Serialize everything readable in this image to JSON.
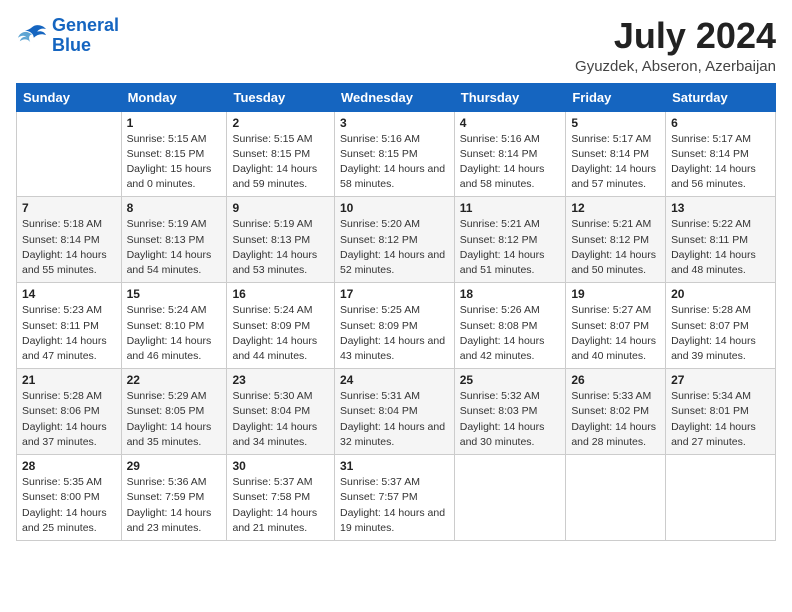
{
  "logo": {
    "line1": "General",
    "line2": "Blue"
  },
  "title": "July 2024",
  "subtitle": "Gyuzdek, Abseron, Azerbaijan",
  "weekdays": [
    "Sunday",
    "Monday",
    "Tuesday",
    "Wednesday",
    "Thursday",
    "Friday",
    "Saturday"
  ],
  "weeks": [
    [
      null,
      {
        "day": "1",
        "sunrise": "5:15 AM",
        "sunset": "8:15 PM",
        "daylight": "15 hours and 0 minutes."
      },
      {
        "day": "2",
        "sunrise": "5:15 AM",
        "sunset": "8:15 PM",
        "daylight": "14 hours and 59 minutes."
      },
      {
        "day": "3",
        "sunrise": "5:16 AM",
        "sunset": "8:15 PM",
        "daylight": "14 hours and 58 minutes."
      },
      {
        "day": "4",
        "sunrise": "5:16 AM",
        "sunset": "8:14 PM",
        "daylight": "14 hours and 58 minutes."
      },
      {
        "day": "5",
        "sunrise": "5:17 AM",
        "sunset": "8:14 PM",
        "daylight": "14 hours and 57 minutes."
      },
      {
        "day": "6",
        "sunrise": "5:17 AM",
        "sunset": "8:14 PM",
        "daylight": "14 hours and 56 minutes."
      }
    ],
    [
      {
        "day": "7",
        "sunrise": "5:18 AM",
        "sunset": "8:14 PM",
        "daylight": "14 hours and 55 minutes."
      },
      {
        "day": "8",
        "sunrise": "5:19 AM",
        "sunset": "8:13 PM",
        "daylight": "14 hours and 54 minutes."
      },
      {
        "day": "9",
        "sunrise": "5:19 AM",
        "sunset": "8:13 PM",
        "daylight": "14 hours and 53 minutes."
      },
      {
        "day": "10",
        "sunrise": "5:20 AM",
        "sunset": "8:12 PM",
        "daylight": "14 hours and 52 minutes."
      },
      {
        "day": "11",
        "sunrise": "5:21 AM",
        "sunset": "8:12 PM",
        "daylight": "14 hours and 51 minutes."
      },
      {
        "day": "12",
        "sunrise": "5:21 AM",
        "sunset": "8:12 PM",
        "daylight": "14 hours and 50 minutes."
      },
      {
        "day": "13",
        "sunrise": "5:22 AM",
        "sunset": "8:11 PM",
        "daylight": "14 hours and 48 minutes."
      }
    ],
    [
      {
        "day": "14",
        "sunrise": "5:23 AM",
        "sunset": "8:11 PM",
        "daylight": "14 hours and 47 minutes."
      },
      {
        "day": "15",
        "sunrise": "5:24 AM",
        "sunset": "8:10 PM",
        "daylight": "14 hours and 46 minutes."
      },
      {
        "day": "16",
        "sunrise": "5:24 AM",
        "sunset": "8:09 PM",
        "daylight": "14 hours and 44 minutes."
      },
      {
        "day": "17",
        "sunrise": "5:25 AM",
        "sunset": "8:09 PM",
        "daylight": "14 hours and 43 minutes."
      },
      {
        "day": "18",
        "sunrise": "5:26 AM",
        "sunset": "8:08 PM",
        "daylight": "14 hours and 42 minutes."
      },
      {
        "day": "19",
        "sunrise": "5:27 AM",
        "sunset": "8:07 PM",
        "daylight": "14 hours and 40 minutes."
      },
      {
        "day": "20",
        "sunrise": "5:28 AM",
        "sunset": "8:07 PM",
        "daylight": "14 hours and 39 minutes."
      }
    ],
    [
      {
        "day": "21",
        "sunrise": "5:28 AM",
        "sunset": "8:06 PM",
        "daylight": "14 hours and 37 minutes."
      },
      {
        "day": "22",
        "sunrise": "5:29 AM",
        "sunset": "8:05 PM",
        "daylight": "14 hours and 35 minutes."
      },
      {
        "day": "23",
        "sunrise": "5:30 AM",
        "sunset": "8:04 PM",
        "daylight": "14 hours and 34 minutes."
      },
      {
        "day": "24",
        "sunrise": "5:31 AM",
        "sunset": "8:04 PM",
        "daylight": "14 hours and 32 minutes."
      },
      {
        "day": "25",
        "sunrise": "5:32 AM",
        "sunset": "8:03 PM",
        "daylight": "14 hours and 30 minutes."
      },
      {
        "day": "26",
        "sunrise": "5:33 AM",
        "sunset": "8:02 PM",
        "daylight": "14 hours and 28 minutes."
      },
      {
        "day": "27",
        "sunrise": "5:34 AM",
        "sunset": "8:01 PM",
        "daylight": "14 hours and 27 minutes."
      }
    ],
    [
      {
        "day": "28",
        "sunrise": "5:35 AM",
        "sunset": "8:00 PM",
        "daylight": "14 hours and 25 minutes."
      },
      {
        "day": "29",
        "sunrise": "5:36 AM",
        "sunset": "7:59 PM",
        "daylight": "14 hours and 23 minutes."
      },
      {
        "day": "30",
        "sunrise": "5:37 AM",
        "sunset": "7:58 PM",
        "daylight": "14 hours and 21 minutes."
      },
      {
        "day": "31",
        "sunrise": "5:37 AM",
        "sunset": "7:57 PM",
        "daylight": "14 hours and 19 minutes."
      },
      null,
      null,
      null
    ]
  ],
  "labels": {
    "sunrise_prefix": "Sunrise: ",
    "sunset_prefix": "Sunset: ",
    "daylight_prefix": "Daylight: "
  }
}
